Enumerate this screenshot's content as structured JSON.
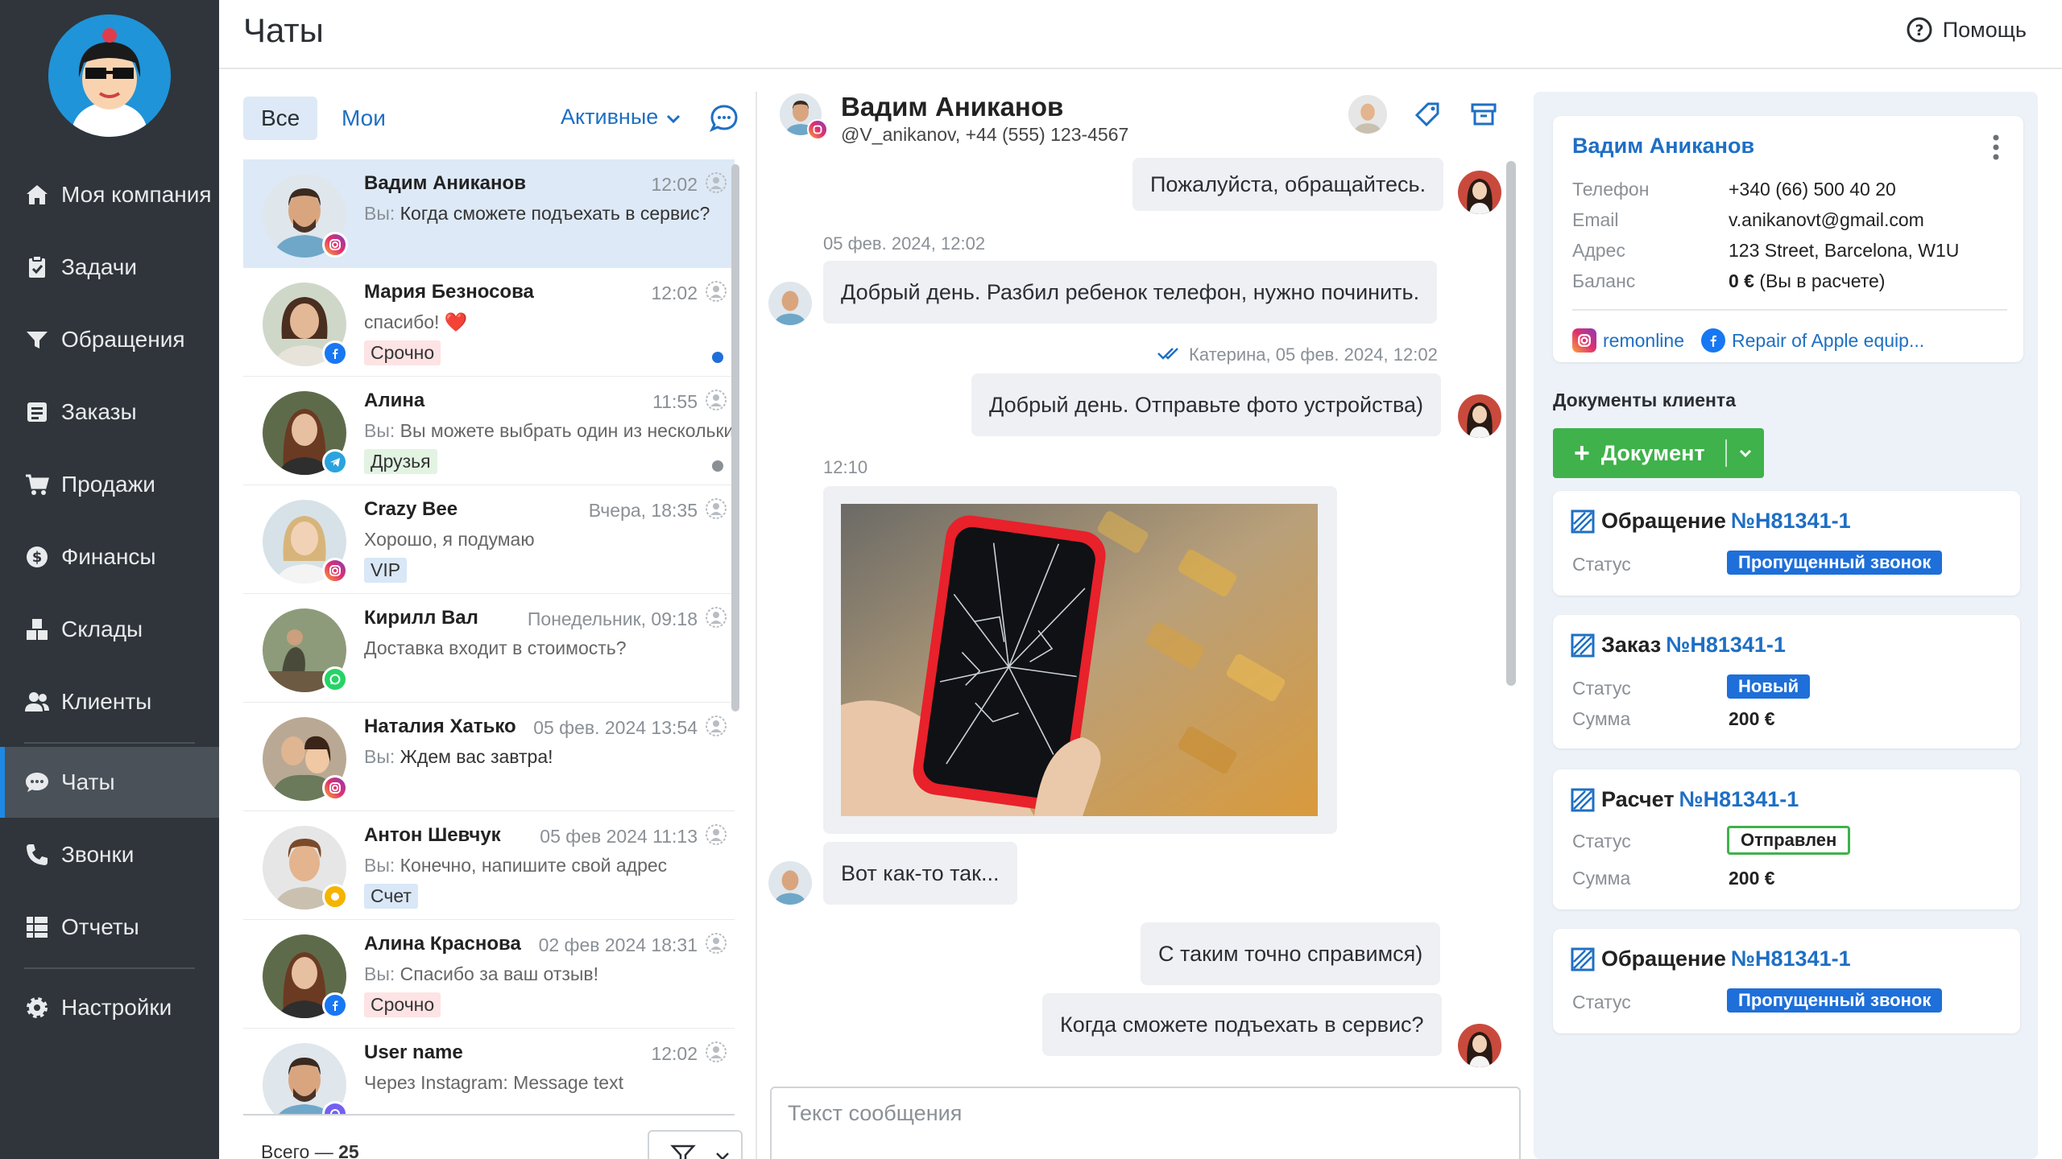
{
  "app": {
    "page_title": "Чаты",
    "help_label": "Помощь"
  },
  "sidebar": {
    "items": [
      {
        "label": "Моя компания",
        "icon": "home-icon"
      },
      {
        "label": "Задачи",
        "icon": "clipboard-icon"
      },
      {
        "label": "Обращения",
        "icon": "funnel-icon"
      },
      {
        "label": "Заказы",
        "icon": "list-icon"
      },
      {
        "label": "Продажи",
        "icon": "cart-icon"
      },
      {
        "label": "Финансы",
        "icon": "dollar-icon"
      },
      {
        "label": "Склады",
        "icon": "boxes-icon"
      },
      {
        "label": "Клиенты",
        "icon": "users-icon"
      },
      {
        "label": "Чаты",
        "icon": "chat-icon",
        "active": true
      },
      {
        "label": "Звонки",
        "icon": "phone-icon"
      },
      {
        "label": "Отчеты",
        "icon": "report-icon"
      },
      {
        "label": "Настройки",
        "icon": "gear-icon"
      }
    ]
  },
  "list": {
    "tab_all": "Все",
    "tab_mine": "Мои",
    "filter_label": "Активные",
    "chats": [
      {
        "name": "Вадим Аниканов",
        "time": "12:02",
        "prefix": "Вы:",
        "text": " Когда сможете подъехать в сервис?",
        "channel": "instagram",
        "tag": "",
        "selected": true
      },
      {
        "name": "Мария Безносова",
        "time": "12:02",
        "prefix": "",
        "text": "спасибо! ❤️",
        "channel": "facebook",
        "tag": "Срочно",
        "tag_color": "red",
        "dot": "#1e6fd9"
      },
      {
        "name": "Алина",
        "time": "11:55",
        "prefix": "Вы:",
        "text": " Вы можете выбрать один из нескольких",
        "channel": "telegram",
        "tag": "Друзья",
        "tag_color": "green",
        "dot": "#8a9096"
      },
      {
        "name": "Crazy Bee",
        "time": "Вчера, 18:35",
        "prefix": "",
        "text": "Хорошо, я подумаю",
        "channel": "instagram",
        "tag": "VIP",
        "tag_color": "blue"
      },
      {
        "name": "Кирилл Вал",
        "time": "Понедельник, 09:18",
        "prefix": "",
        "text": "Доставка входит в стоимость?",
        "channel": "whatsapp",
        "tag": ""
      },
      {
        "name": "Наталия Хатько",
        "time": "05 фев. 2024 13:54",
        "prefix": "Вы:",
        "text": " Ждем вас завтра!",
        "channel": "instagram",
        "tag": ""
      },
      {
        "name": "Антон Шевчук",
        "time": "05 фев 2024 11:13",
        "prefix": "Вы:",
        "text": " Конечно, напишите свой адрес",
        "channel": "other",
        "tag": "Счет",
        "tag_color": "blue"
      },
      {
        "name": "Алина Краснова",
        "time": "02 фев 2024 18:31",
        "prefix": "Вы:",
        "text": " Спасибо за ваш отзыв!",
        "channel": "facebook",
        "tag": "Срочно",
        "tag_color": "red"
      },
      {
        "name": "User name",
        "time": "12:02",
        "prefix": "",
        "text": "Через Instagram: Message text",
        "channel": "viber",
        "tag": ""
      }
    ],
    "total_label": "Всего —",
    "total_value": "25"
  },
  "conversation": {
    "name": "Вадим Аниканов",
    "subtitle": "@V_anikanov, +44 (555) 123-4567",
    "messages": {
      "m1": "Пожалуйста, обращайтесь.",
      "m1_meta": "05 фев. 2024, 12:02",
      "m2": "Добрый день. Разбил ребенок телефон, нужно починить.",
      "m3_meta": "Катерина, 05 фев. 2024, 12:02",
      "m3": "Добрый день. Отправьте фото устройства)",
      "m4_meta": "12:10",
      "m5": "Вот как-то так...",
      "m6": "С таким точно справимся)",
      "m7": "Когда сможете подъехать в сервис?"
    },
    "composer_placeholder": "Текст сообщения"
  },
  "client": {
    "name": "Вадим Аниканов",
    "phone_label": "Телефон",
    "phone": "+340 (66) 500 40 20",
    "email_label": "Email",
    "email": "v.anikanovt@gmail.com",
    "address_label": "Адрес",
    "address": "123 Street, Barcelona, W1U",
    "balance_label": "Баланс",
    "balance_value": "0 €",
    "balance_note": " (Вы в расчете)",
    "link1": "remonline",
    "link2": "Repair of Apple equip..."
  },
  "docs": {
    "title": "Документы клиента",
    "add_label": "Документ",
    "items": [
      {
        "type": "Обращение",
        "num": "№H81341-1",
        "status_label": "Статус",
        "status": "Пропущенный звонок"
      },
      {
        "type": "Заказ",
        "num": "№H81341-1",
        "status_label": "Статус",
        "status": "Новый",
        "sum_label": "Сумма",
        "sum": "200 €"
      },
      {
        "type": "Расчет",
        "num": "№H81341-1",
        "status_label": "Статус",
        "status": "Отправлен",
        "sum_label": "Сумма",
        "sum": "200 €"
      },
      {
        "type": "Обращение",
        "num": "№H81341-1",
        "status_label": "Статус",
        "status": "Пропущенный звонок"
      }
    ]
  },
  "colors": {
    "accent": "#1e6fc4",
    "sidebar": "#2f353b",
    "success": "#3fb24b",
    "status_blue": "#1e6fd9"
  }
}
